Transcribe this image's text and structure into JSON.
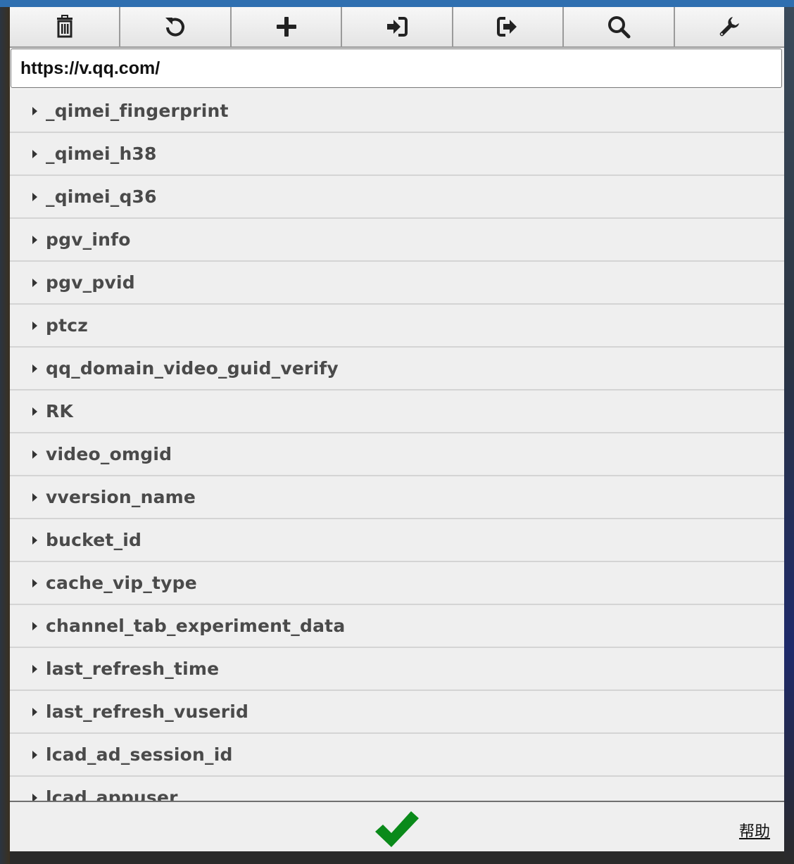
{
  "toolbar": {
    "buttons": [
      {
        "icon": "trash-icon"
      },
      {
        "icon": "refresh-icon"
      },
      {
        "icon": "plus-icon"
      },
      {
        "icon": "import-icon"
      },
      {
        "icon": "export-icon"
      },
      {
        "icon": "search-icon"
      },
      {
        "icon": "wrench-icon"
      }
    ]
  },
  "url": {
    "value": "https://v.qq.com/"
  },
  "cookies": [
    "_qimei_fingerprint",
    "_qimei_h38",
    "_qimei_q36",
    "pgv_info",
    "pgv_pvid",
    "ptcz",
    "qq_domain_video_guid_verify",
    "RK",
    "video_omgid",
    "vversion_name",
    "bucket_id",
    "cache_vip_type",
    "channel_tab_experiment_data",
    "last_refresh_time",
    "last_refresh_vuserid",
    "lcad_ad_session_id",
    "lcad_appuser"
  ],
  "footer": {
    "confirm_icon": "checkmark-icon",
    "help_label": "帮助"
  },
  "colors": {
    "confirm": "#0a8a1a",
    "toolbar_icon": "#222222"
  }
}
